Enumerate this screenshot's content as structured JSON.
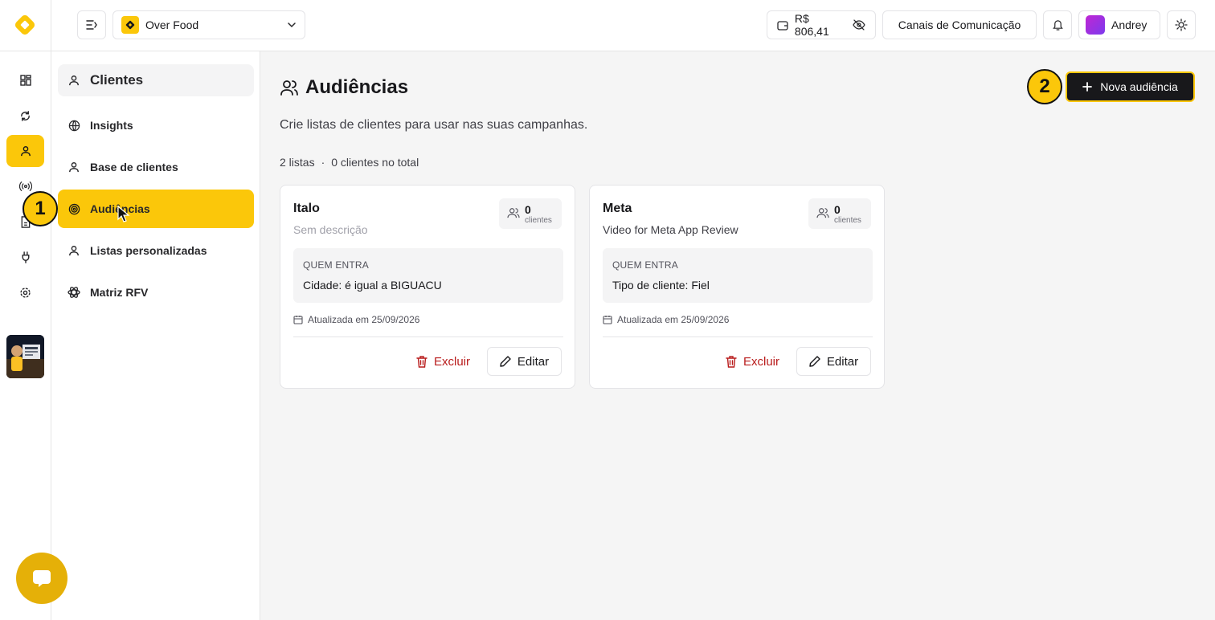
{
  "colors": {
    "accent": "#fbc70a",
    "danger": "#b91c1c",
    "dark": "#18181b"
  },
  "header": {
    "store_name": "Over Food",
    "balance": "R$ 806,41",
    "channels_label": "Canais de Comunicação",
    "user_name": "Andrey"
  },
  "subnav": {
    "title": "Clientes",
    "items": [
      {
        "label": "Insights",
        "icon": "globe-icon"
      },
      {
        "label": "Base de clientes",
        "icon": "user-icon"
      },
      {
        "label": "Audiências",
        "icon": "target-icon"
      },
      {
        "label": "Listas personalizadas",
        "icon": "user-icon"
      },
      {
        "label": "Matriz RFV",
        "icon": "atom-icon"
      }
    ]
  },
  "main": {
    "title": "Audiências",
    "subtitle": "Crie listas de clientes para usar nas suas campanhas.",
    "stats_lists": "2 listas",
    "stats_sep": "·",
    "stats_clients": "0 clientes no total",
    "new_button": "Nova audiência"
  },
  "cards": [
    {
      "title": "Italo",
      "description": "Sem descrição",
      "count": "0",
      "count_label": "clientes",
      "rule_label": "QUEM ENTRA",
      "rule_value": "Cidade: é igual a BIGUACU",
      "updated": "Atualizada em 25/09/2026",
      "delete_label": "Excluir",
      "edit_label": "Editar"
    },
    {
      "title": "Meta",
      "description": "Video for Meta App Review",
      "count": "0",
      "count_label": "clientes",
      "rule_label": "QUEM ENTRA",
      "rule_value": "Tipo de cliente: Fiel",
      "updated": "Atualizada em 25/09/2026",
      "delete_label": "Excluir",
      "edit_label": "Editar"
    }
  ],
  "annotations": {
    "step1": "1",
    "step2": "2"
  }
}
